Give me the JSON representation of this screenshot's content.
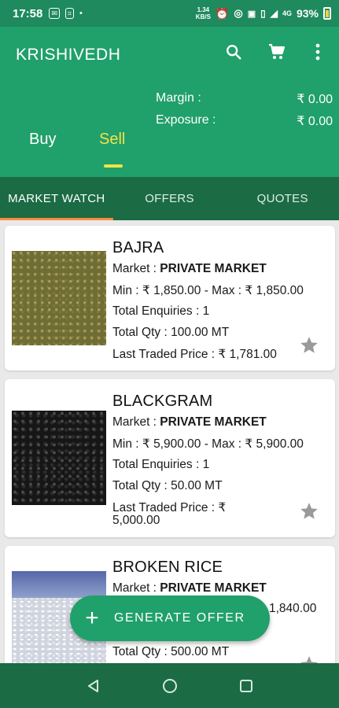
{
  "status": {
    "time": "17:58",
    "speed_top": "1.34",
    "speed_bottom": "KB/S",
    "network": "4G",
    "battery": "93%"
  },
  "header": {
    "app_title": "KRISHIVEDH",
    "margin_label": "Margin :",
    "margin_value": "₹ 0.00",
    "exposure_label": "Exposure :",
    "exposure_value": "₹ 0.00",
    "buy_label": "Buy",
    "sell_label": "Sell",
    "active_color": "#f2e24a"
  },
  "tabs": [
    {
      "label": "MARKET WATCH"
    },
    {
      "label": "OFFERS"
    },
    {
      "label": "QUOTES"
    }
  ],
  "items": [
    {
      "name": "BAJRA",
      "market_label": "Market :",
      "market_value": "PRIVATE MARKET",
      "price_range": "Min : ₹ 1,850.00 - Max : ₹ 1,850.00",
      "enquiries": "Total Enquiries : 1",
      "qty": "Total Qty : 100.00 MT",
      "ltp_line1": "Last Traded Price : ₹ 1,781.00",
      "ltp_line2": ""
    },
    {
      "name": "BLACKGRAM",
      "market_label": "Market :",
      "market_value": "PRIVATE MARKET",
      "price_range": "Min : ₹ 5,900.00 - Max : ₹ 5,900.00",
      "enquiries": "Total Enquiries : 1",
      "qty": "Total Qty : 50.00 MT",
      "ltp_line1": "Last Traded Price : ₹",
      "ltp_line2": "5,000.00"
    },
    {
      "name": "BROKEN RICE",
      "market_label": "Market :",
      "market_value": "PRIVATE MARKET",
      "price_range_visible": "1,840.00",
      "enquiries": "",
      "qty": "Total Qty : 500.00 MT"
    }
  ],
  "fab": {
    "label": "GENERATE OFFER"
  },
  "colors": {
    "primary": "#20a06a",
    "dark": "#1b6b44",
    "accent": "#ff8a3d"
  }
}
